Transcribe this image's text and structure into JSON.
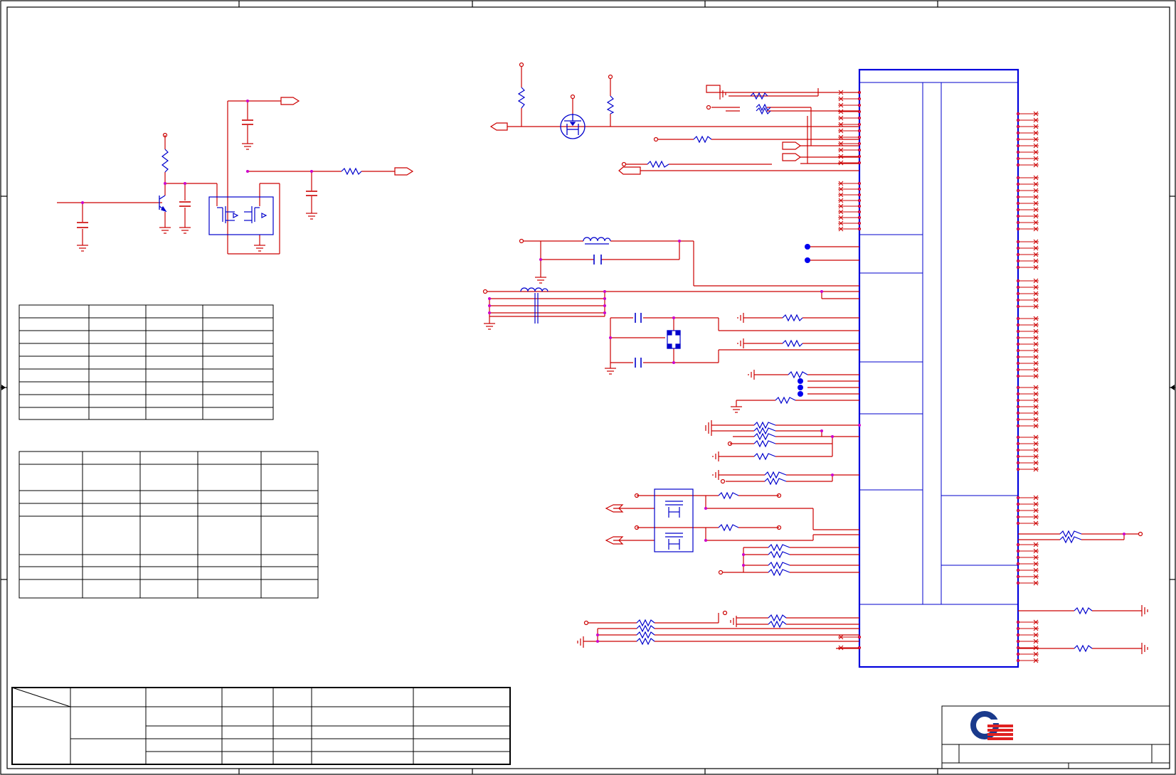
{
  "sheet": {
    "background": "#ffffff",
    "border_color": "#000000",
    "wire_color": "#cc0000",
    "part_color": "#0000cc",
    "junction_color": "#cc00cc"
  },
  "icons": {
    "logo": "quanta-q-logo-icon",
    "resistor": "resistor-symbol-icon",
    "capacitor": "capacitor-symbol-icon",
    "ground": "ground-symbol-icon",
    "mosfet": "mosfet-symbol-icon",
    "transistor": "npn-transistor-symbol-icon",
    "inductor": "inductor-symbol-icon",
    "port": "off-sheet-connector-icon"
  },
  "logo": {
    "ring_color": "#1a3a8c",
    "stripe_color": "#e02020"
  },
  "title_block": {
    "rows": 3
  },
  "tables": {
    "table_a_rows": 9,
    "table_a_cols": 4,
    "table_b_rows": 7,
    "table_b_cols": 5,
    "revision_rows": 4,
    "revision_cols": 7
  }
}
